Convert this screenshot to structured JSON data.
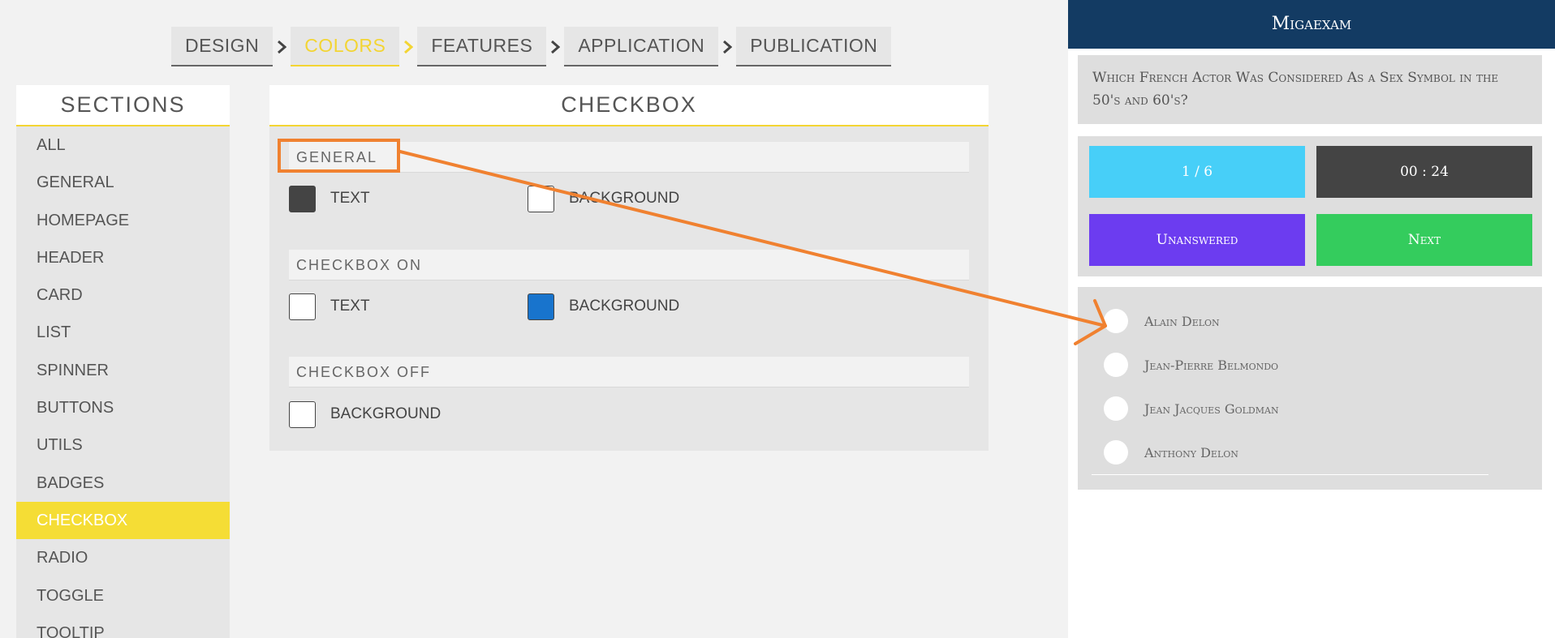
{
  "breadcrumb": {
    "steps": [
      {
        "label": "DESIGN",
        "active": false
      },
      {
        "label": "COLORS",
        "active": true
      },
      {
        "label": "FEATURES",
        "active": false
      },
      {
        "label": "APPLICATION",
        "active": false
      },
      {
        "label": "PUBLICATION",
        "active": false
      }
    ]
  },
  "sidebar": {
    "title": "SECTIONS",
    "items": [
      {
        "label": "ALL"
      },
      {
        "label": "GENERAL"
      },
      {
        "label": "HOMEPAGE"
      },
      {
        "label": "HEADER"
      },
      {
        "label": "CARD"
      },
      {
        "label": "LIST"
      },
      {
        "label": "SPINNER"
      },
      {
        "label": "BUTTONS"
      },
      {
        "label": "UTILS"
      },
      {
        "label": "BADGES"
      },
      {
        "label": "CHECKBOX",
        "active": true
      },
      {
        "label": "RADIO"
      },
      {
        "label": "TOGGLE"
      },
      {
        "label": "TOOLTIP"
      }
    ]
  },
  "panel": {
    "title": "CHECKBOX",
    "groups": [
      {
        "header": "GENERAL",
        "options": [
          {
            "label": "TEXT",
            "color": "#444444"
          },
          {
            "label": "BACKGROUND",
            "color": "#ffffff"
          }
        ]
      },
      {
        "header": "CHECKBOX ON",
        "options": [
          {
            "label": "TEXT",
            "color": "#ffffff"
          },
          {
            "label": "BACKGROUND",
            "color": "#1874cd"
          }
        ]
      },
      {
        "header": "CHECKBOX OFF",
        "options": [
          {
            "label": "BACKGROUND",
            "color": "#ffffff"
          }
        ]
      }
    ]
  },
  "preview": {
    "app_title": "Migaexam",
    "question": "Which French Actor Was Considered As a Sex Symbol in the 50's and 60's?",
    "progress_label": "1 / 6",
    "timer": "00 : 24",
    "unanswered_label": "Unanswered",
    "next_label": "Next",
    "answers": [
      {
        "label": "Alain Delon"
      },
      {
        "label": "Jean-Pierre Belmondo"
      },
      {
        "label": "Jean Jacques Goldman"
      },
      {
        "label": "Anthony Delon"
      }
    ]
  },
  "colors": {
    "accent_yellow": "#f3d533",
    "header_navy": "#133b63",
    "progress_cyan": "#47cff8",
    "timer_dark": "#444444",
    "unanswered_purple": "#6c3cf0",
    "next_green": "#34cc5d",
    "annotation_orange": "#f08130"
  }
}
